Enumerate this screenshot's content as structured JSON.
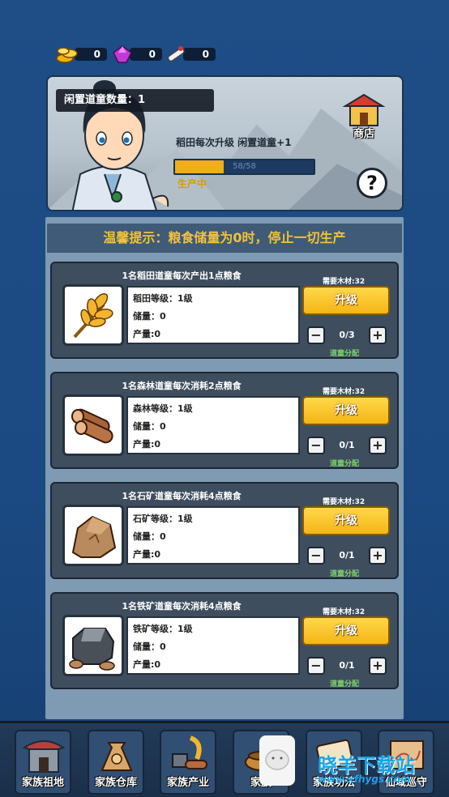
{
  "resources": [
    {
      "icon": "gold-coin-icon",
      "value": "0"
    },
    {
      "icon": "purple-gem-icon",
      "value": "0"
    },
    {
      "icon": "scroll-icon",
      "value": "0"
    }
  ],
  "hero": {
    "idle_label": "闲置道童数量：1",
    "rule_text": "稻田每次升级 闲置道童+1",
    "progress": 0.35,
    "progress_text": "58/58",
    "status": "生产中",
    "shop_label": "商店",
    "help": "?"
  },
  "tip": "温馨提示：粮食储量为0时，停止一切生产",
  "cards": [
    {
      "title": "1名稻田道童每次产出1点粮食",
      "icon": "wheat-icon",
      "level": "稻田等级：1级",
      "storage": "储量：0",
      "output": "产量:0",
      "need": "需要木材:32",
      "upgrade": "升级",
      "count": "0/3",
      "assign": "道童分配"
    },
    {
      "title": "1名森林道童每次消耗2点粮食",
      "icon": "wood-log-icon",
      "level": "森林等级：1级",
      "storage": "储量：0",
      "output": "产量:0",
      "need": "需要木材:32",
      "upgrade": "升级",
      "count": "0/1",
      "assign": "道童分配"
    },
    {
      "title": "1名石矿道童每次消耗4点粮食",
      "icon": "stone-icon",
      "level": "石矿等级：1级",
      "storage": "储量：0",
      "output": "产量:0",
      "need": "需要木材:32",
      "upgrade": "升级",
      "count": "0/1",
      "assign": "道童分配"
    },
    {
      "title": "1名铁矿道童每次消耗4点粮食",
      "icon": "iron-ore-icon",
      "level": "铁矿等级：1级",
      "storage": "储量：0",
      "output": "产量:0",
      "need": "需要木材:32",
      "upgrade": "升级",
      "count": "0/1",
      "assign": "道童分配"
    }
  ],
  "nav": [
    {
      "label": "家族祖地",
      "icon": "ancestral-hall-icon"
    },
    {
      "label": "家族仓库",
      "icon": "warehouse-bag-icon"
    },
    {
      "label": "家族产业",
      "icon": "industry-icon"
    },
    {
      "label": "家族",
      "icon": "cauldron-icon"
    },
    {
      "label": "家族功法",
      "icon": "scroll-book-icon"
    },
    {
      "label": "仙域巡守",
      "icon": "map-icon"
    }
  ],
  "watermark": {
    "text": "晓羊下载站",
    "url": "www.xfhygs.com"
  }
}
